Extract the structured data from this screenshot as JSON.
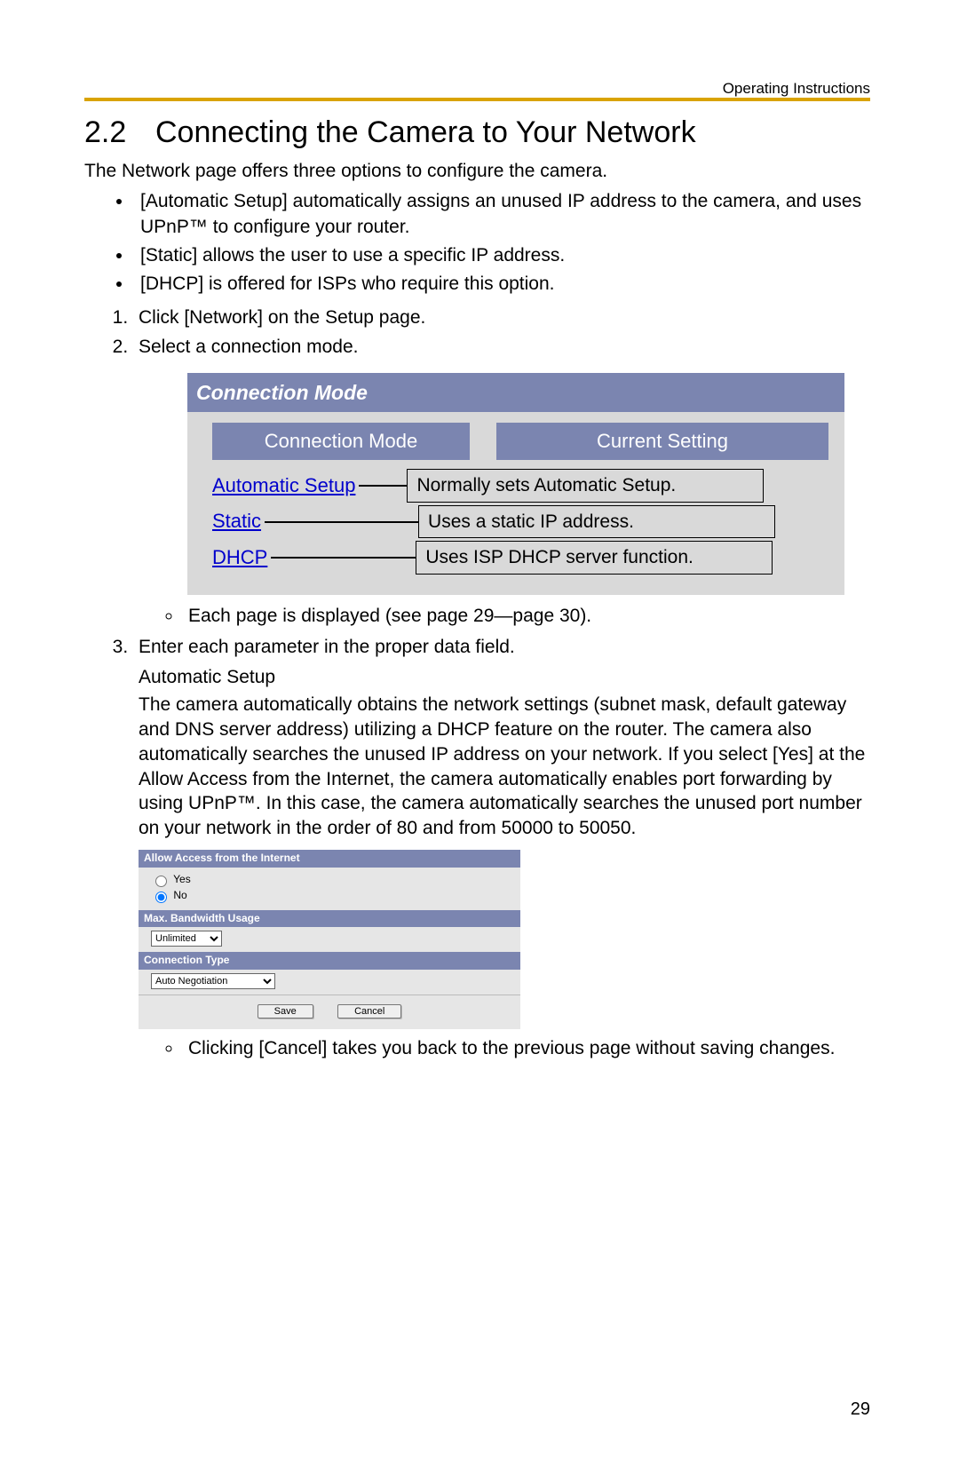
{
  "running_header": "Operating Instructions",
  "section_number": "2.2",
  "section_title": "Connecting the Camera to Your Network",
  "intro": "The Network page offers three options to configure the camera.",
  "bullets": [
    "[Automatic Setup] automatically assigns an unused IP address to the camera, and uses UPnP™ to configure your router.",
    "[Static] allows the user to use a specific IP address.",
    "[DHCP] is offered for ISPs who require this option."
  ],
  "steps": {
    "s1": "Click [Network] on the Setup page.",
    "s2": "Select a connection mode.",
    "s3": "Enter each parameter in the proper data field."
  },
  "conn_panel": {
    "title": "Connection Mode",
    "col_mode": "Connection Mode",
    "col_setting": "Current Setting",
    "rows": [
      {
        "link": "Automatic Setup",
        "desc": "Normally sets Automatic Setup."
      },
      {
        "link": "Static",
        "desc": "Uses a static IP address."
      },
      {
        "link": "DHCP",
        "desc": "Uses ISP DHCP server function."
      }
    ]
  },
  "each_page_note": "Each page is displayed (see page 29—page 30).",
  "autosetup": {
    "heading": "Automatic Setup",
    "text": "The camera automatically obtains the network settings (subnet mask, default gateway and DNS server address) utilizing a DHCP feature on the router. The camera also automatically searches the unused IP address on your network. If you select [Yes] at the Allow Access from the Internet, the camera automatically enables port forwarding by using UPnP™. In this case, the camera automatically searches the unused port number on your network in the order of 80 and from 50000 to 50050."
  },
  "settings": {
    "allow_access_title": "Allow Access from the Internet",
    "yes": "Yes",
    "no": "No",
    "bandwidth_title": "Max. Bandwidth Usage",
    "bandwidth_value": "Unlimited",
    "conn_type_title": "Connection Type",
    "conn_type_value": "Auto Negotiation",
    "save": "Save",
    "cancel": "Cancel"
  },
  "cancel_note": "Clicking [Cancel] takes you back to the previous page without saving changes.",
  "page_number": "29"
}
